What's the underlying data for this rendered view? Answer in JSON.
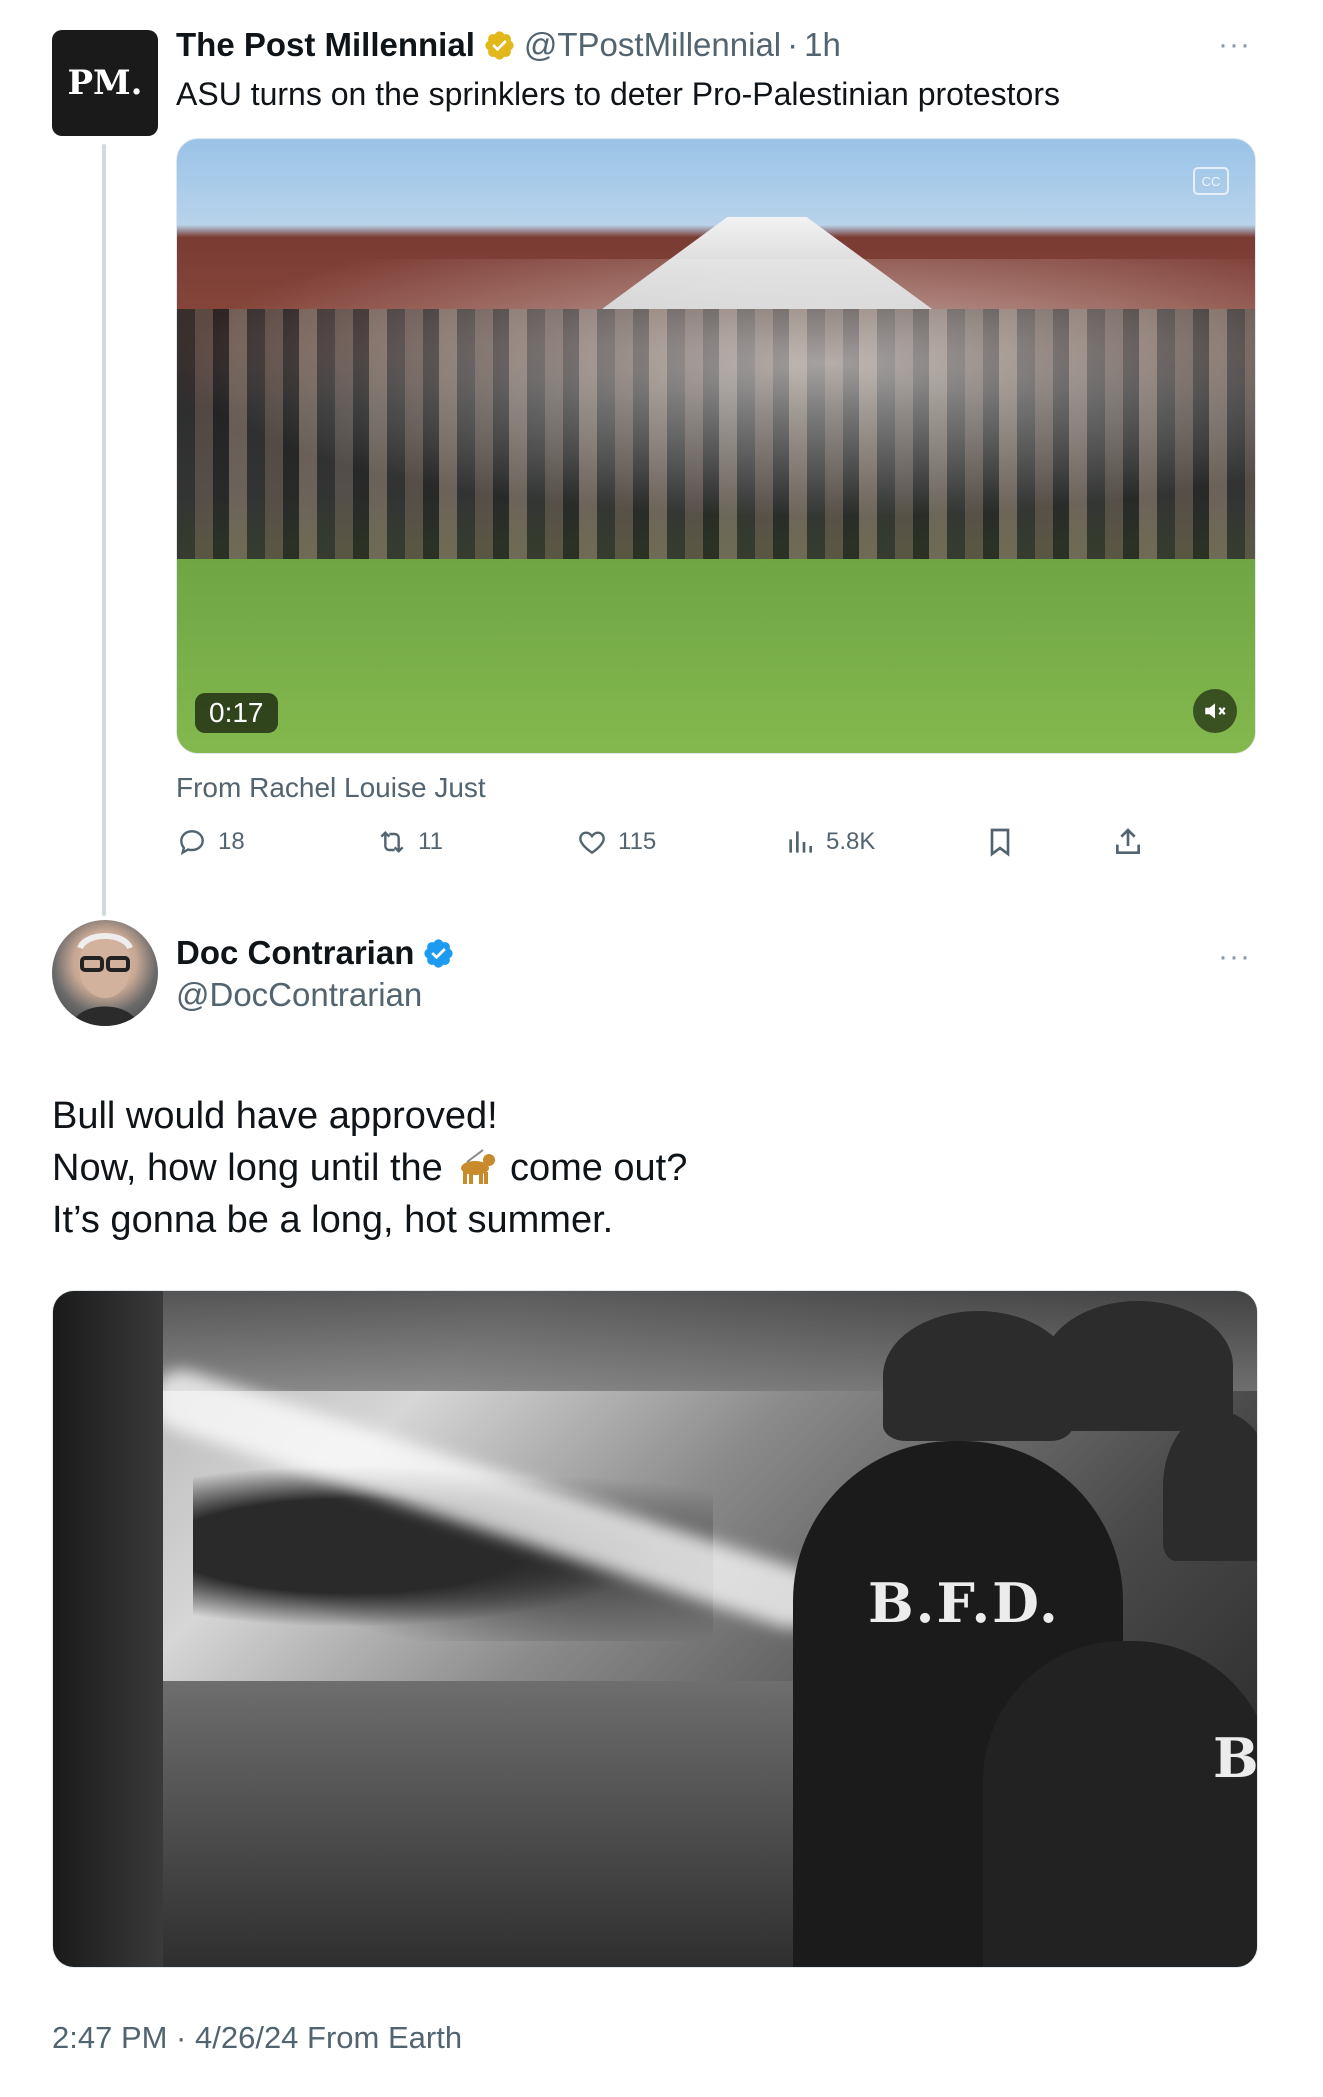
{
  "parent_tweet": {
    "avatar_text": "PM.",
    "name": "The Post Millennial",
    "handle": "@TPostMillennial",
    "separator": "·",
    "time": "1h",
    "more": "···",
    "text": "ASU turns on the sprinklers to deter Pro-Palestinian protestors",
    "video": {
      "duration": "0:17",
      "cc_label": "CC"
    },
    "source": "From Rachel Louise Just",
    "actions": {
      "replies": "18",
      "reposts": "11",
      "likes": "115",
      "views": "5.8K"
    },
    "colors": {
      "verified_badge": "#e2b719"
    }
  },
  "main_tweet": {
    "name": "Doc Contrarian",
    "handle": "@DocContrarian",
    "more": "···",
    "lines": [
      "Bull would have approved!",
      "Now, how long until the",
      "come out?",
      "It’s gonna be a long, hot summer."
    ],
    "emoji": "guide-dog",
    "photo": {
      "jacket_text_1": "B.F.D.",
      "jacket_text_2": "B"
    },
    "timestamp": "2:47 PM · 4/26/24 From Earth",
    "colors": {
      "verified_badge": "#1d9bf0"
    }
  }
}
